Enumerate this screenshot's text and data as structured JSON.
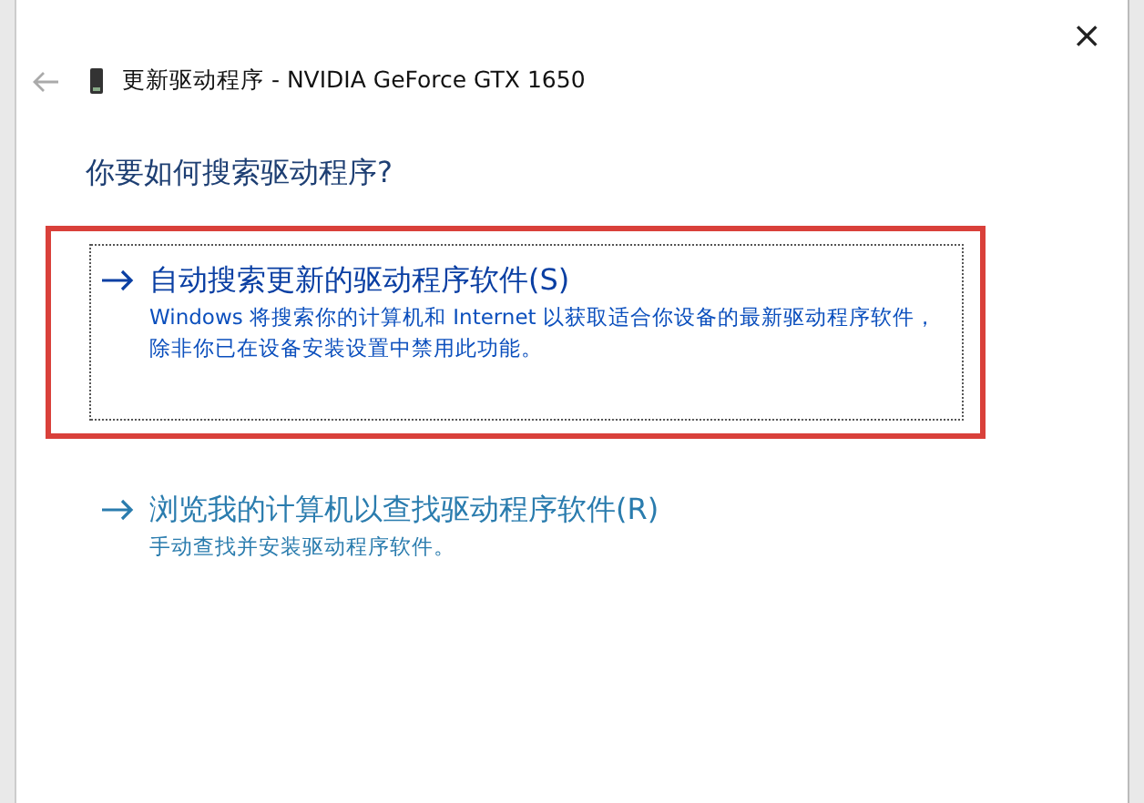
{
  "window": {
    "title": "更新驱动程序 - NVIDIA GeForce GTX 1650",
    "close": "×"
  },
  "heading": "你要如何搜索驱动程序?",
  "options": [
    {
      "title": "自动搜索更新的驱动程序软件(S)",
      "description": "Windows 将搜索你的计算机和 Internet 以获取适合你设备的最新驱动程序软件，除非你已在设备安装设置中禁用此功能。",
      "focused": true,
      "highlighted": true
    },
    {
      "title": "浏览我的计算机以查找驱动程序软件(R)",
      "description": "手动查找并安装驱动程序软件。",
      "focused": false,
      "highlighted": false
    }
  ]
}
